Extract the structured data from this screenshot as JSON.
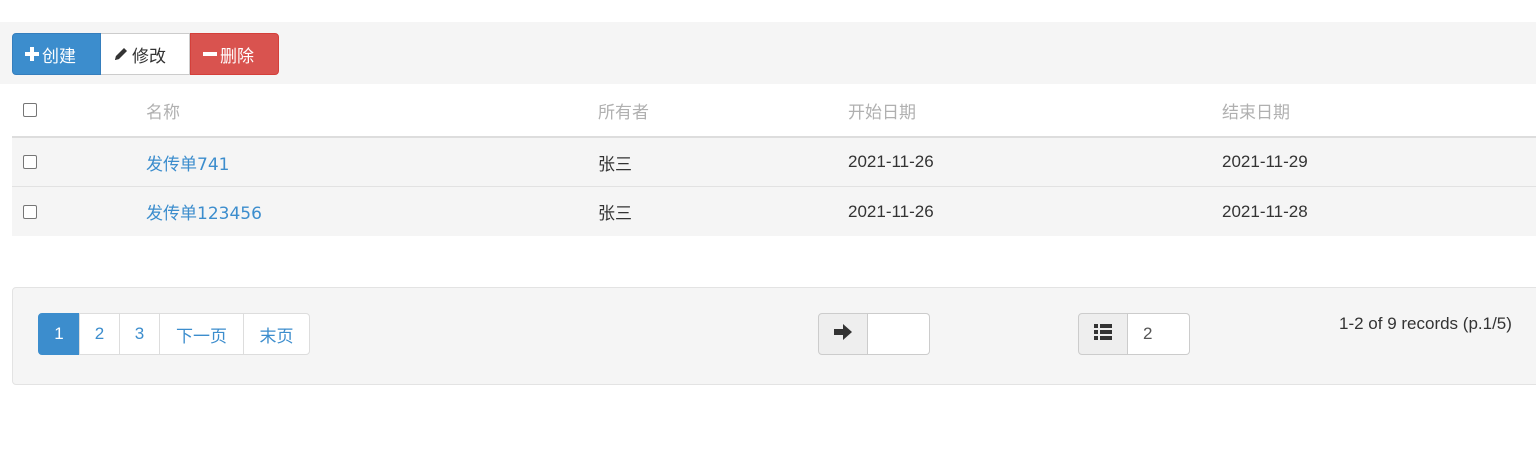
{
  "toolbar": {
    "create_label": "创建",
    "edit_label": "修改",
    "delete_label": "删除"
  },
  "table": {
    "headers": [
      "名称",
      "所有者",
      "开始日期",
      "结束日期"
    ],
    "rows": [
      {
        "name": "发传单741",
        "owner": "张三",
        "start": "2021-11-26",
        "end": "2021-11-29"
      },
      {
        "name": "发传单123456",
        "owner": "张三",
        "start": "2021-11-26",
        "end": "2021-11-28"
      }
    ]
  },
  "pagination": {
    "pages": [
      "1",
      "2",
      "3"
    ],
    "current": "1",
    "next_label": "下一页",
    "last_label": "末页"
  },
  "jump": {
    "value": ""
  },
  "page_size": {
    "value": "2"
  },
  "records_text": "1-2 of 9 records (p.1/5)",
  "colors": {
    "primary": "#3c8dcd",
    "danger": "#d9534f"
  }
}
